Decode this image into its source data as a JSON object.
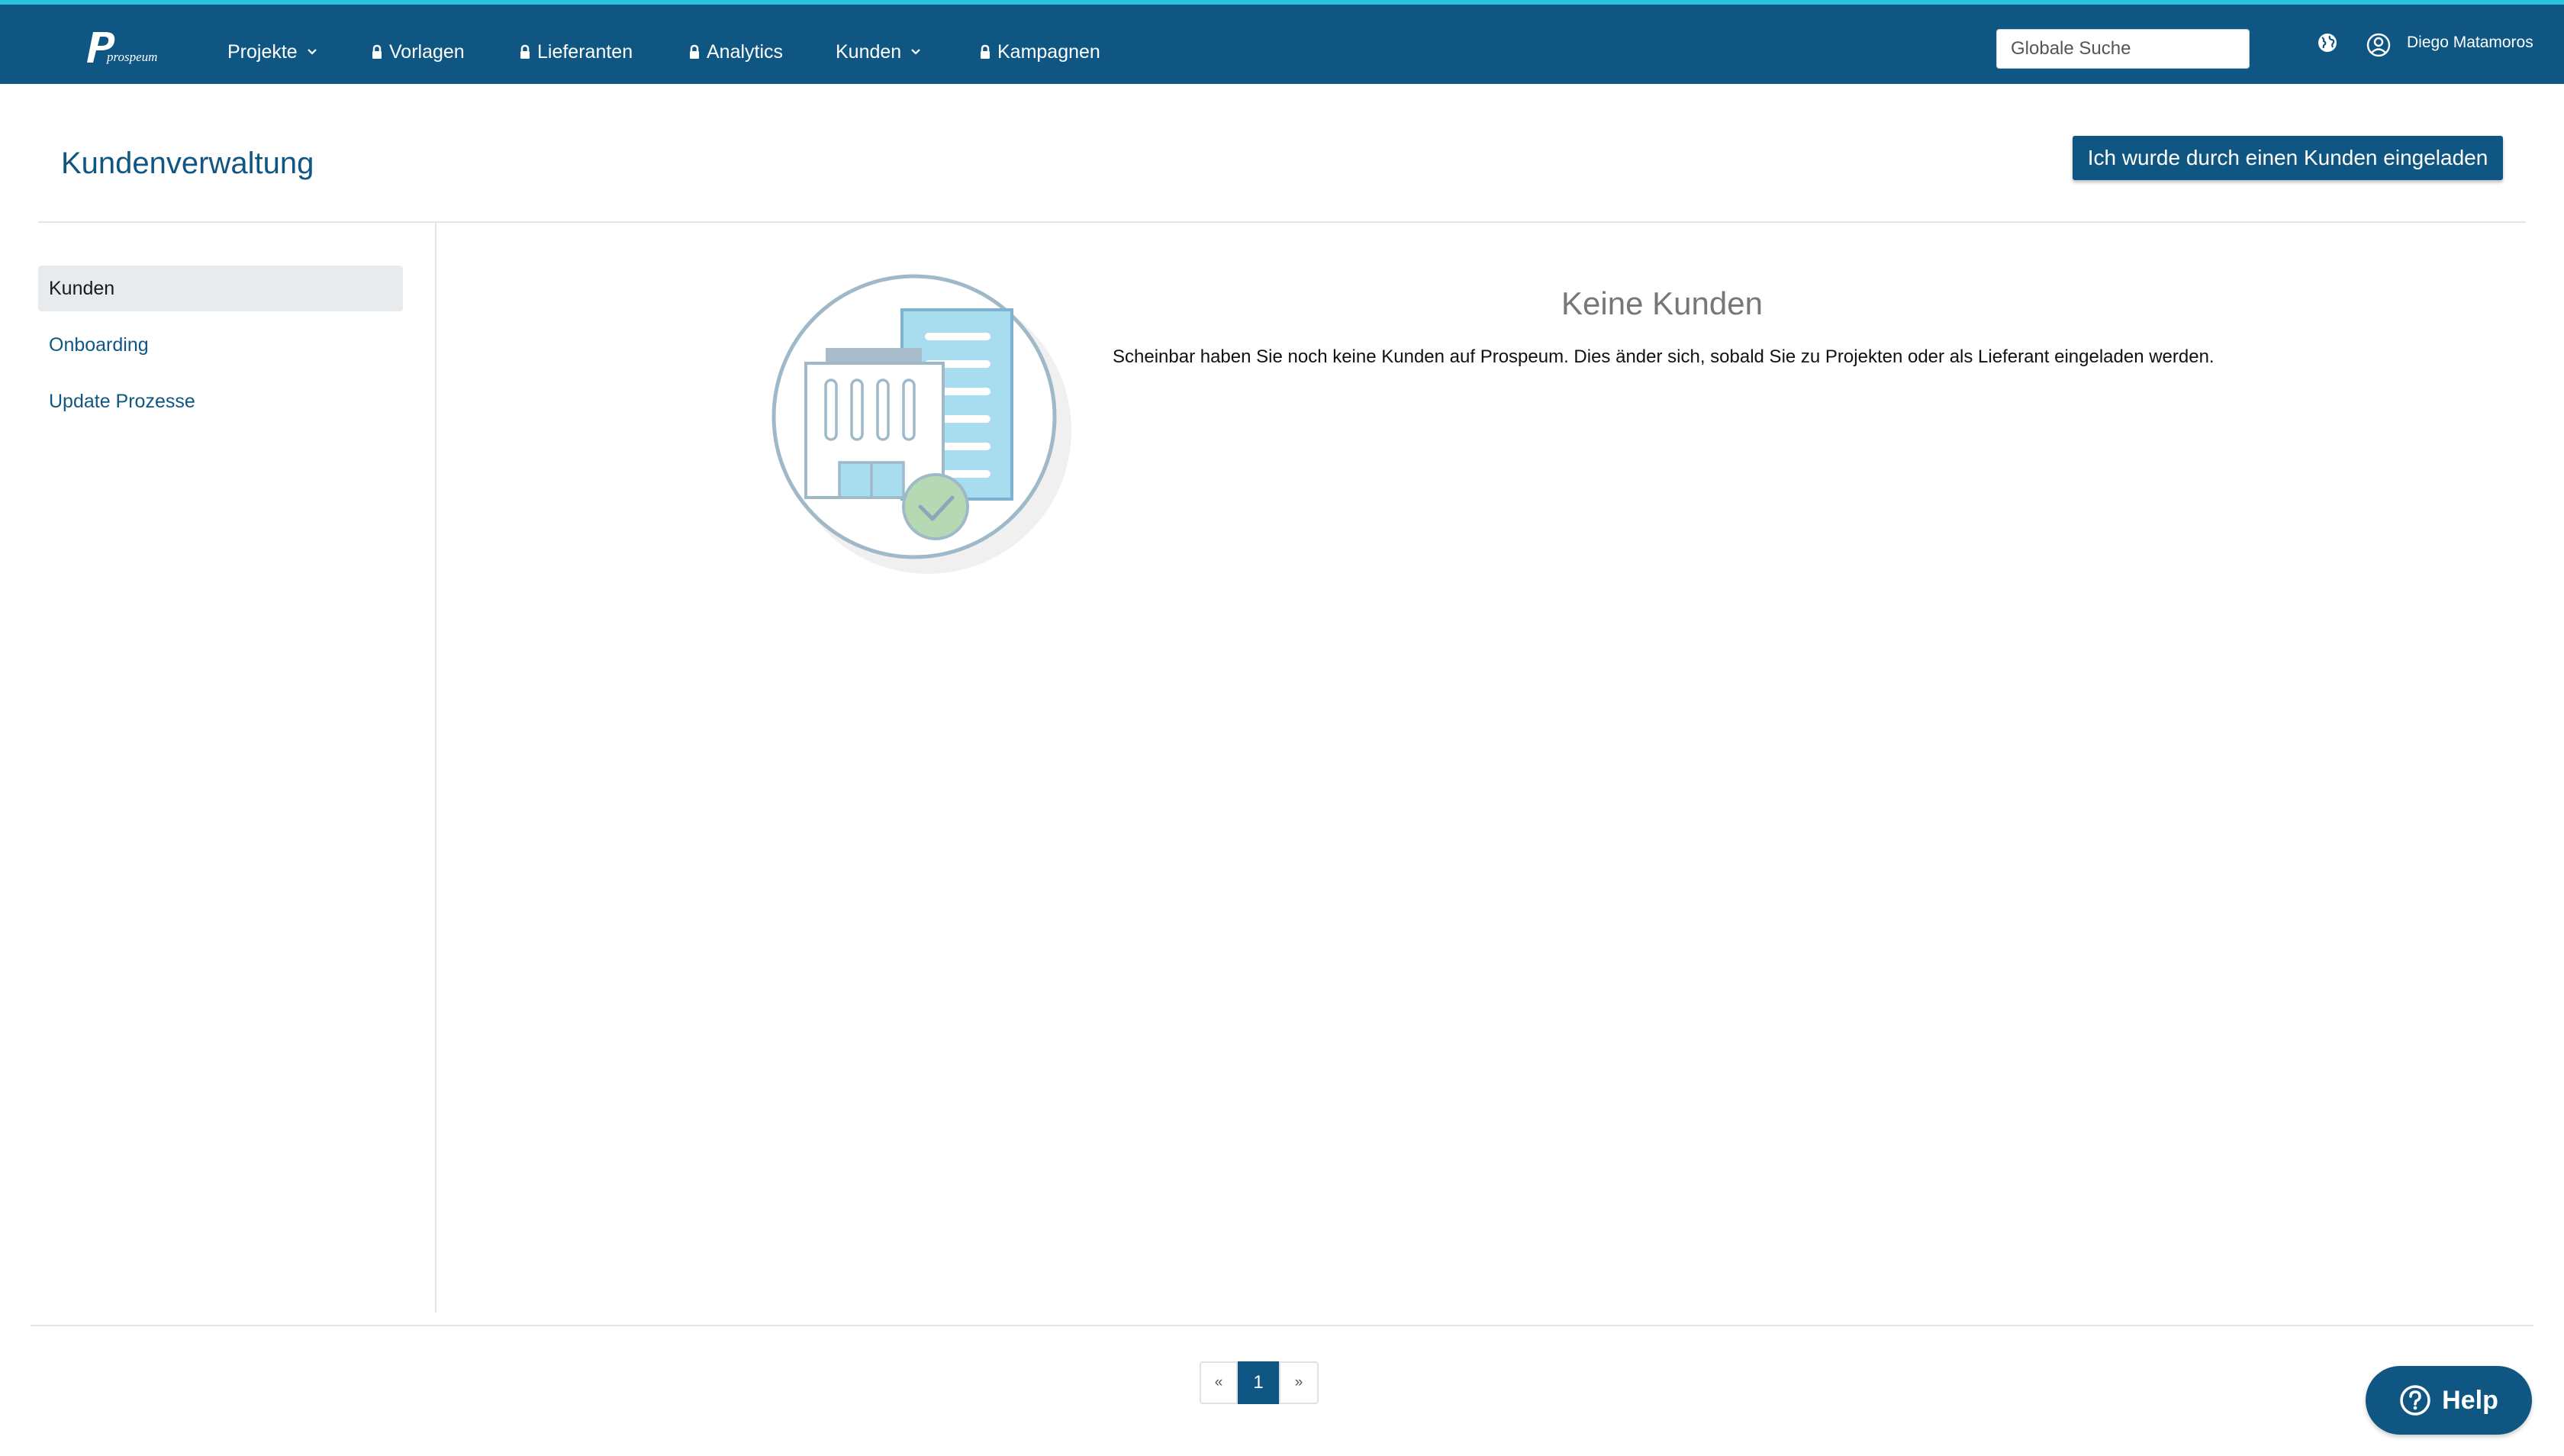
{
  "app": {
    "logo_text": "prospeum"
  },
  "nav": {
    "items": [
      {
        "label": "Projekte",
        "locked": false,
        "dropdown": true
      },
      {
        "label": "Vorlagen",
        "locked": true,
        "dropdown": false
      },
      {
        "label": "Lieferanten",
        "locked": true,
        "dropdown": false
      },
      {
        "label": "Analytics",
        "locked": true,
        "dropdown": false
      },
      {
        "label": "Kunden",
        "locked": false,
        "dropdown": true
      },
      {
        "label": "Kampagnen",
        "locked": true,
        "dropdown": false
      }
    ],
    "search_placeholder": "Globale Suche",
    "user_name": "Diego Matamoros",
    "icons": {
      "language": "globe-icon",
      "user": "user-circle-icon",
      "lock": "lock-icon",
      "dropdown": "chevron-down-icon"
    }
  },
  "header": {
    "title": "Kundenverwaltung",
    "invite_button": "Ich wurde durch einen Kunden eingeladen"
  },
  "sidebar": {
    "items": [
      {
        "label": "Kunden",
        "active": true
      },
      {
        "label": "Onboarding",
        "active": false
      },
      {
        "label": "Update Prozesse",
        "active": false
      }
    ]
  },
  "empty_state": {
    "title": "Keine Kunden",
    "message": "Scheinbar haben Sie noch keine Kunden auf Prospeum. Dies änder sich, sobald Sie zu Projekten oder als Lieferant eingeladen werden."
  },
  "pagination": {
    "prev": "«",
    "current": "1",
    "next": "»"
  },
  "help": {
    "label": "Help"
  },
  "colors": {
    "primary": "#0f5782",
    "topbar_accent": "#29c5e0",
    "active_bg": "#e8ebee",
    "muted_title": "#777777"
  }
}
